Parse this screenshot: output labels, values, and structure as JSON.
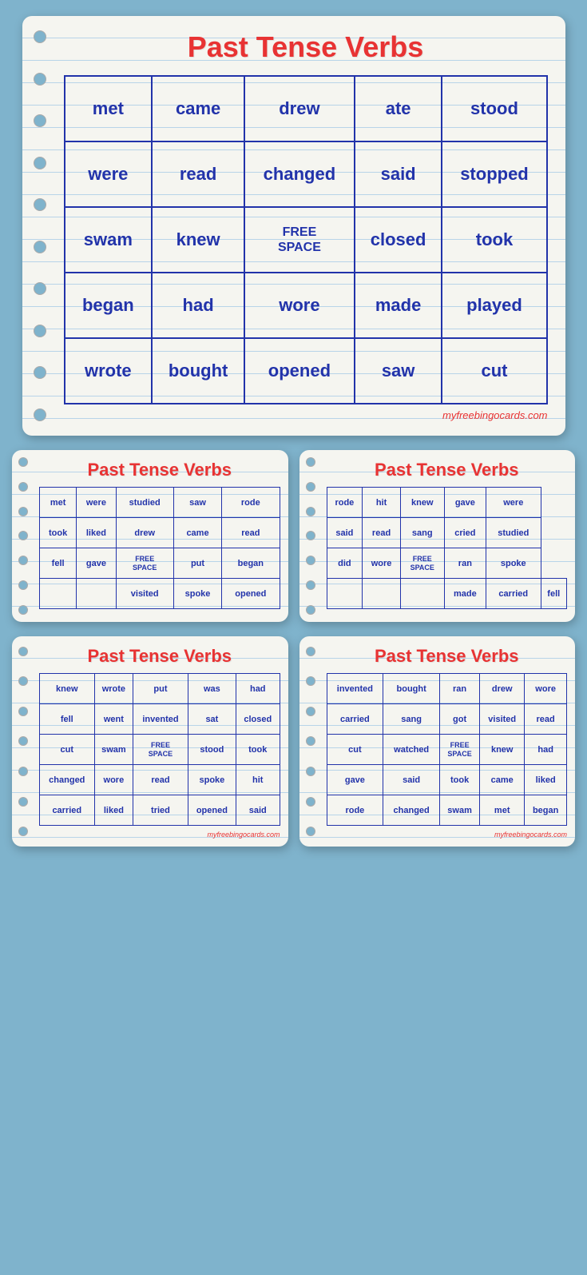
{
  "main_card": {
    "title": "Past Tense Verbs",
    "grid": [
      [
        "met",
        "came",
        "drew",
        "ate",
        "stood"
      ],
      [
        "were",
        "read",
        "changed",
        "said",
        "stopped"
      ],
      [
        "swam",
        "knew",
        "FREE\nSPACE",
        "closed",
        "took"
      ],
      [
        "began",
        "had",
        "wore",
        "made",
        "played"
      ],
      [
        "wrote",
        "bought",
        "opened",
        "saw",
        "cut"
      ]
    ],
    "free_space_row": 2,
    "free_space_col": 2,
    "footer": "myfreebingocards.com"
  },
  "small_card_1": {
    "title": "Past Tense Verbs",
    "grid": [
      [
        "met",
        "were",
        "studied",
        "saw",
        "rode"
      ],
      [
        "took",
        "liked",
        "drew",
        "came",
        "read"
      ],
      [
        "fell",
        "gave",
        "FREE\nSPACE",
        "put",
        "began"
      ],
      [
        "",
        "",
        "visited",
        "spoke",
        "opened"
      ]
    ],
    "footer": ""
  },
  "small_card_2": {
    "title": "Past Tense Verbs",
    "grid": [
      [
        "rode",
        "hit",
        "knew",
        "gave",
        "were"
      ],
      [
        "said",
        "read",
        "sang",
        "cried",
        "studied"
      ],
      [
        "did",
        "wore",
        "FREE\nSPACE",
        "ran",
        "spoke"
      ],
      [
        "",
        "",
        "",
        "made",
        "carried",
        "fell"
      ]
    ],
    "footer": ""
  },
  "small_card_3": {
    "title": "Past Tense Verbs",
    "grid": [
      [
        "knew",
        "wrote",
        "put",
        "was",
        "had"
      ],
      [
        "fell",
        "went",
        "invented",
        "sat",
        "closed"
      ],
      [
        "cut",
        "swam",
        "FREE\nSPACE",
        "stood",
        "took"
      ],
      [
        "changed",
        "wore",
        "read",
        "spoke",
        "hit"
      ],
      [
        "carried",
        "liked",
        "tried",
        "opened",
        "said"
      ]
    ],
    "footer": "myfreebingocards.com"
  },
  "small_card_4": {
    "title": "Past Tense Verbs",
    "grid": [
      [
        "invented",
        "bought",
        "ran",
        "drew",
        "wore"
      ],
      [
        "carried",
        "sang",
        "got",
        "visited",
        "read"
      ],
      [
        "cut",
        "watched",
        "FREE\nSPACE",
        "knew",
        "had"
      ],
      [
        "gave",
        "said",
        "took",
        "came",
        "liked"
      ],
      [
        "rode",
        "changed",
        "swam",
        "met",
        "began"
      ]
    ],
    "footer": "myfreebingocards.com"
  }
}
